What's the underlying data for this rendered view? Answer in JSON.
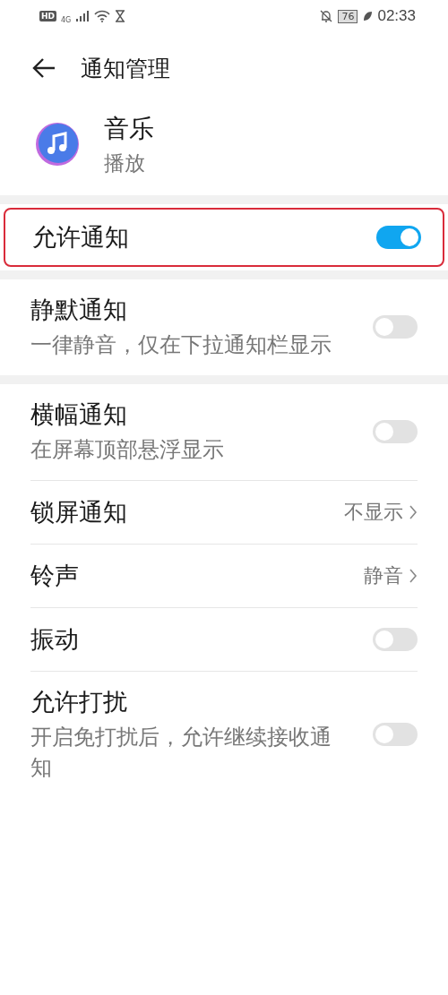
{
  "status_bar": {
    "hd": "HD",
    "network": "4G",
    "battery": "76",
    "time": "02:33"
  },
  "header": {
    "title": "通知管理"
  },
  "app": {
    "name": "音乐",
    "subtitle": "播放"
  },
  "groups": [
    {
      "rows": [
        {
          "kind": "toggle",
          "title": "允许通知",
          "on": true,
          "highlighted": true
        }
      ]
    },
    {
      "rows": [
        {
          "kind": "toggle",
          "title": "静默通知",
          "subtitle": "一律静音，仅在下拉通知栏显示",
          "on": false,
          "highlighted": false
        }
      ]
    },
    {
      "rows": [
        {
          "kind": "toggle",
          "title": "横幅通知",
          "subtitle": "在屏幕顶部悬浮显示",
          "on": false,
          "highlighted": false
        },
        {
          "kind": "value",
          "title": "锁屏通知",
          "value": "不显示",
          "highlighted": false
        },
        {
          "kind": "value",
          "title": "铃声",
          "value": "静音",
          "highlighted": false
        },
        {
          "kind": "toggle",
          "title": "振动",
          "on": false,
          "highlighted": false
        },
        {
          "kind": "toggle",
          "title": "允许打扰",
          "subtitle": "开启免打扰后，允许继续接收通知",
          "on": false,
          "highlighted": false
        }
      ]
    }
  ]
}
